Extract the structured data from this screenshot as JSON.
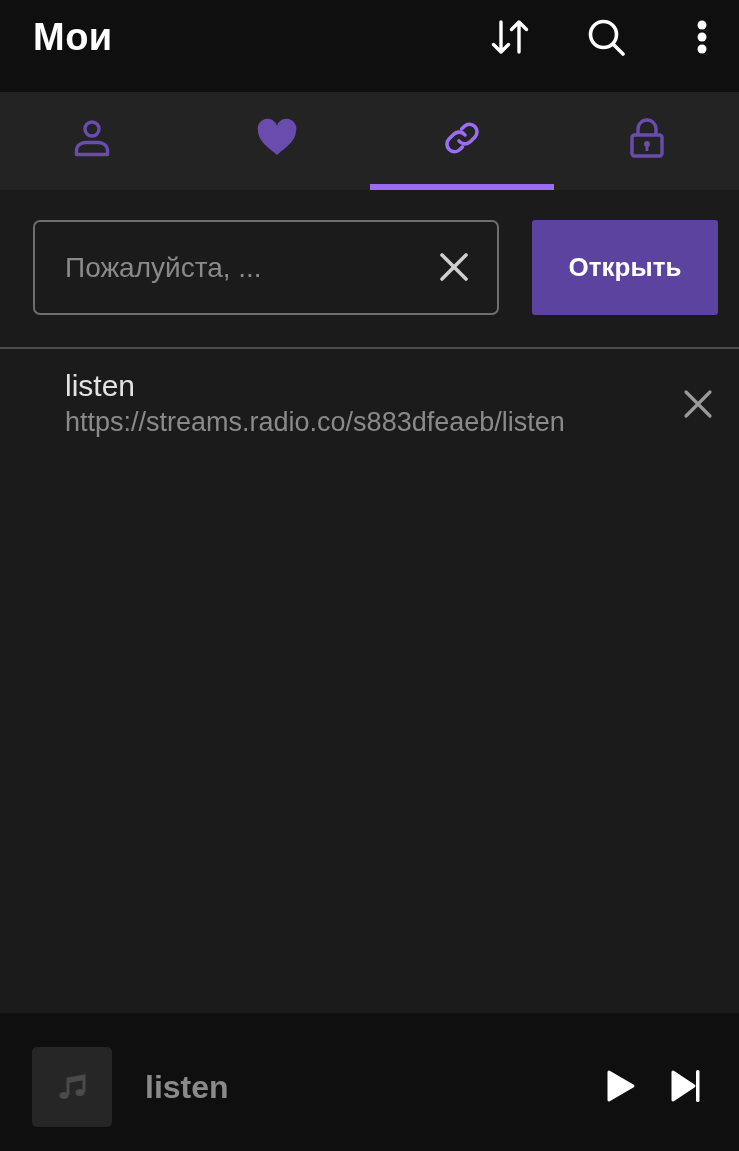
{
  "header": {
    "title": "Мои"
  },
  "tabs": [
    {
      "selected": false
    },
    {
      "selected": false
    },
    {
      "selected": true
    },
    {
      "selected": false
    }
  ],
  "search": {
    "placeholder": "Пожалуйста, ..."
  },
  "open_button": {
    "label": "Открыть"
  },
  "links": [
    {
      "title": "listen",
      "url": "https://streams.radio.co/s883dfeaeb/listen"
    }
  ],
  "player": {
    "title": "listen"
  }
}
